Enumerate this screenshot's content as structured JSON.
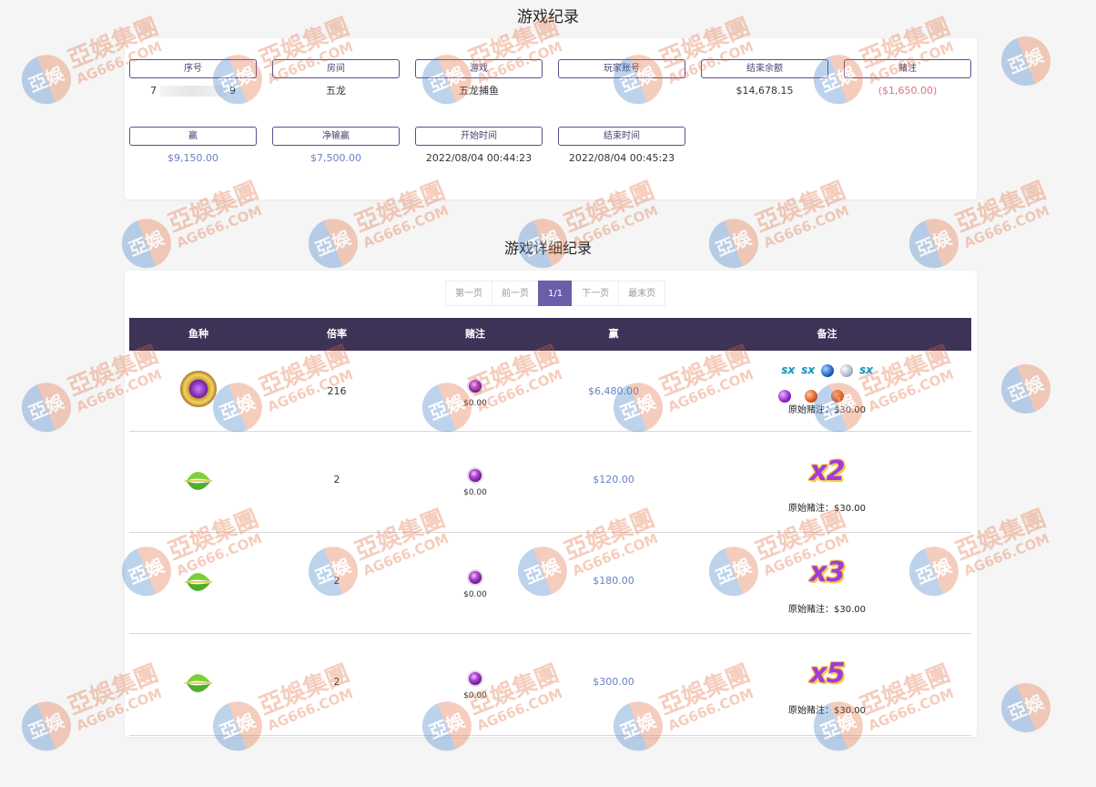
{
  "page_title": "游戏纪录",
  "summary": {
    "fields": [
      {
        "label": "序号",
        "value_prefix": "7",
        "value_suffix": "9"
      },
      {
        "label": "房间",
        "value": "五龙"
      },
      {
        "label": "游戏",
        "value": "五龙捕鱼"
      },
      {
        "label": "玩家账号",
        "value": ""
      },
      {
        "label": "结束余额",
        "value": "$14,678.15"
      },
      {
        "label": "赌注",
        "value": "($1,650.00)"
      },
      {
        "label": "赢",
        "value": "$9,150.00"
      },
      {
        "label": "净输赢",
        "value": "$7,500.00"
      },
      {
        "label": "开始时间",
        "value": "2022/08/04 00:44:23"
      },
      {
        "label": "结束时间",
        "value": "2022/08/04 00:45:23"
      }
    ]
  },
  "detail_title": "游戏详细纪录",
  "pager": {
    "first": "第一页",
    "prev": "前一页",
    "current": "1/1",
    "next": "下一页",
    "last": "最末页"
  },
  "table": {
    "headers": [
      "鱼种",
      "倍率",
      "赌注",
      "赢",
      "备注"
    ],
    "rows": [
      {
        "fish_icon": "golden-dragon-orb-icon",
        "multiplier": "216",
        "bet": "$0.00",
        "win": "$6,480.00",
        "note_type": "symbols",
        "note": "原始赌注：$30.00"
      },
      {
        "fish_icon": "green-feather-icon",
        "multiplier": "2",
        "bet": "$0.00",
        "win": "$120.00",
        "note_type": "badge",
        "badge": "x2",
        "note": "原始赌注：$30.00"
      },
      {
        "fish_icon": "green-feather-icon",
        "multiplier": "2",
        "bet": "$0.00",
        "win": "$180.00",
        "note_type": "badge",
        "badge": "x3",
        "note": "原始赌注：$30.00"
      },
      {
        "fish_icon": "green-feather-icon",
        "multiplier": "2",
        "bet": "$0.00",
        "win": "$300.00",
        "note_type": "badge",
        "badge": "x5",
        "note": "原始赌注：$30.00"
      }
    ],
    "row1_symbols_top": [
      "SX",
      "SX",
      "blue-orb",
      "silver-orb",
      "SX"
    ],
    "row1_symbols_bottom": [
      "purple-orb",
      "orange-orb",
      "orange-orb"
    ]
  },
  "watermark": {
    "logo_text": "亞娛",
    "name": "亞娛集團",
    "domain": "AG666.COM"
  },
  "colors": {
    "accent": "#6a5ea8",
    "header_bg": "#3d3357",
    "money": "#6a7fc5",
    "negative": "#d9737f"
  }
}
